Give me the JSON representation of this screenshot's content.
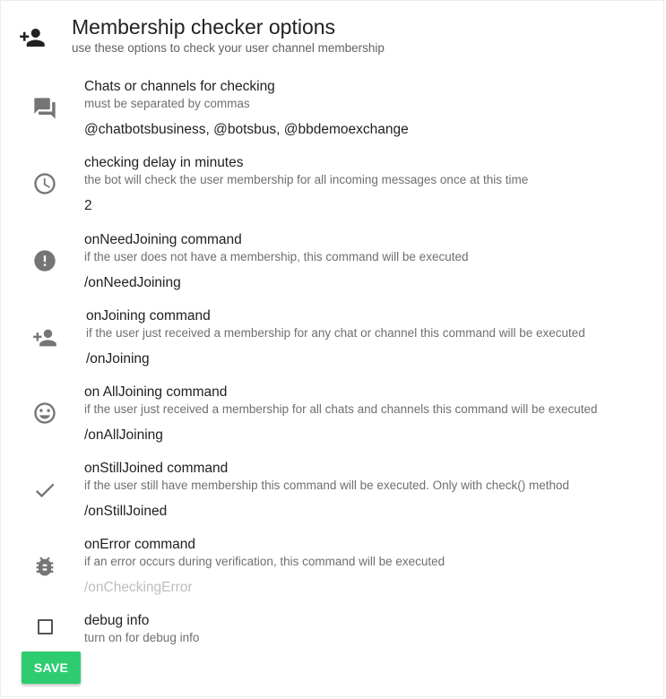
{
  "header": {
    "title": "Membership checker options",
    "subtitle": "use these options to check your user channel membership",
    "icon": "person-add-icon"
  },
  "options": [
    {
      "title": "Chats or channels for checking",
      "description": "must be separated by commas",
      "value": "@chatbotsbusiness, @botsbus, @bbdemoexchange",
      "placeholder": "",
      "icon": "forum-icon"
    },
    {
      "title": "checking delay in minutes",
      "description": "the bot will check the user membership for all incoming messages once at this time",
      "value": "2",
      "placeholder": "",
      "icon": "clock-icon"
    },
    {
      "title": "onNeedJoining command",
      "description": "if the user does not have a membership, this command will be executed",
      "value": "/onNeedJoining",
      "placeholder": "",
      "icon": "alert-circle-icon"
    },
    {
      "title": "onJoining command",
      "description": "if the user just received a membership for any chat or channel this command will be executed",
      "value": "/onJoining",
      "placeholder": "",
      "icon": "person-add-icon"
    },
    {
      "title": "on AllJoining command",
      "description": "if the user just received a membership for all chats and channels this command will be executed",
      "value": "/onAllJoining",
      "placeholder": "",
      "icon": "smiley-icon"
    },
    {
      "title": "onStillJoined command",
      "description": "if the user still have membership this command will be executed. Only with check() method",
      "value": "/onStillJoined",
      "placeholder": "",
      "icon": "check-icon"
    },
    {
      "title": "onError command",
      "description": "if an error occurs during verification, this command will be executed",
      "value": "",
      "placeholder": "/onCheckingError",
      "icon": "bug-icon"
    }
  ],
  "debug": {
    "title": "debug info",
    "description": "turn on for debug info",
    "checked": false
  },
  "save_label": "SAVE",
  "colors": {
    "accent": "#2ecc71",
    "icon": "#757575",
    "placeholder": "#bdbdbd"
  }
}
